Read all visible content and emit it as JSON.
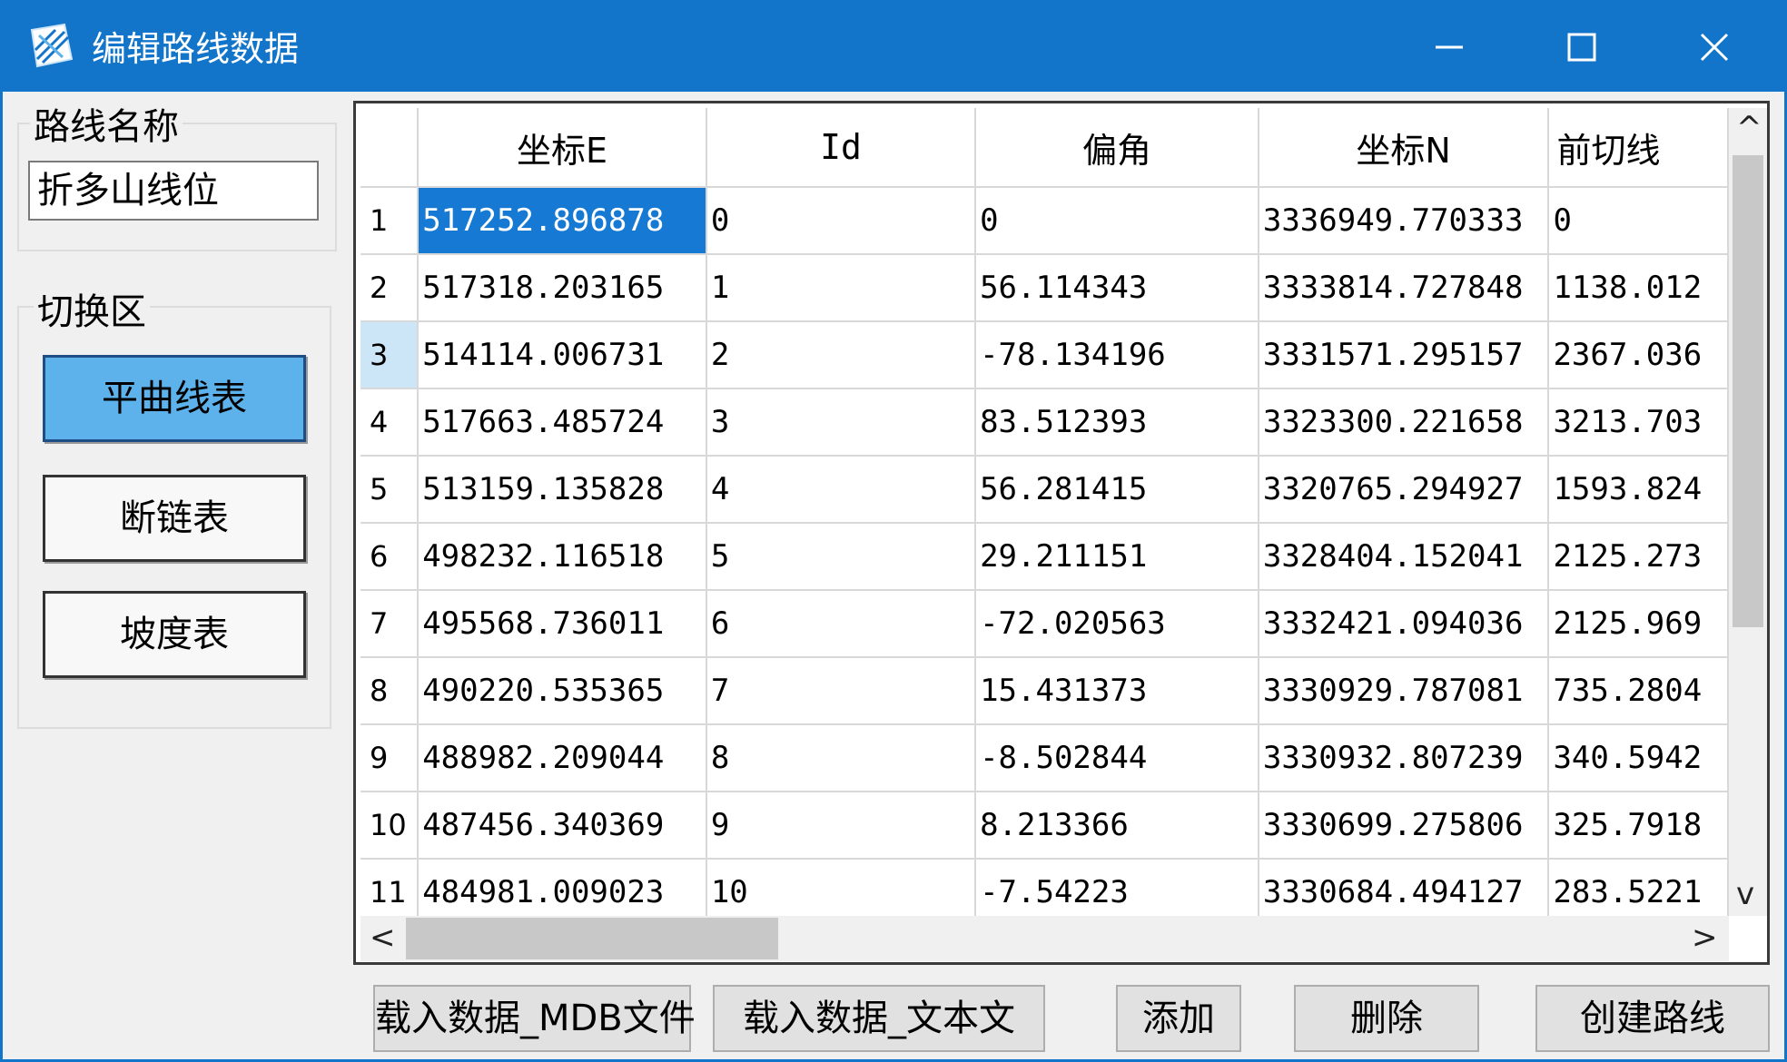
{
  "window": {
    "title": "编辑路线数据",
    "accent": "#1275c9",
    "minimize_icon": "minimize-icon",
    "maximize_icon": "maximize-icon",
    "close_icon": "close-icon"
  },
  "route_name": {
    "label": "路线名称",
    "value": "折多山线位"
  },
  "switch_area": {
    "label": "切换区",
    "buttons": [
      {
        "label": "平曲线表",
        "active": true
      },
      {
        "label": "断链表",
        "active": false
      },
      {
        "label": "坡度表",
        "active": false
      }
    ]
  },
  "grid": {
    "columns": [
      "坐标E",
      "Id",
      "偏角",
      "坐标N",
      "前切线"
    ],
    "rows": [
      {
        "n": "1",
        "cells": [
          "517252.896878",
          "0",
          "0",
          "3336949.770333",
          "0"
        ]
      },
      {
        "n": "2",
        "cells": [
          "517318.203165",
          "1",
          "56.114343",
          "3333814.727848",
          "1138.012"
        ]
      },
      {
        "n": "3",
        "cells": [
          "514114.006731",
          "2",
          "-78.134196",
          "3331571.295157",
          "2367.036"
        ]
      },
      {
        "n": "4",
        "cells": [
          "517663.485724",
          "3",
          "83.512393",
          "3323300.221658",
          "3213.703"
        ]
      },
      {
        "n": "5",
        "cells": [
          "513159.135828",
          "4",
          "56.281415",
          "3320765.294927",
          "1593.824"
        ]
      },
      {
        "n": "6",
        "cells": [
          "498232.116518",
          "5",
          "29.211151",
          "3328404.152041",
          "2125.273"
        ]
      },
      {
        "n": "7",
        "cells": [
          "495568.736011",
          "6",
          "-72.020563",
          "3332421.094036",
          "2125.969"
        ]
      },
      {
        "n": "8",
        "cells": [
          "490220.535365",
          "7",
          "15.431373",
          "3330929.787081",
          "735.2804"
        ]
      },
      {
        "n": "9",
        "cells": [
          "488982.209044",
          "8",
          "-8.502844",
          "3330932.807239",
          "340.5942"
        ]
      },
      {
        "n": "10",
        "cells": [
          "487456.340369",
          "9",
          "8.213366",
          "3330699.275806",
          "325.7918"
        ]
      },
      {
        "n": "11",
        "cells": [
          "484981.009023",
          "10",
          "-7.54223",
          "3330684.494127",
          "283.5221"
        ]
      }
    ],
    "selected_cell": {
      "row": 1,
      "column": "坐标E"
    },
    "selection_color": "#1679d4"
  },
  "scroll": {
    "up_arrow": "^",
    "down_arrow": "v",
    "left_arrow": "<",
    "right_arrow": ">"
  },
  "actions": {
    "load_mdb": "载入数据_MDB文件",
    "load_text": "载入数据_文本文",
    "add": "添加",
    "delete": "删除",
    "create_route": "创建路线"
  }
}
